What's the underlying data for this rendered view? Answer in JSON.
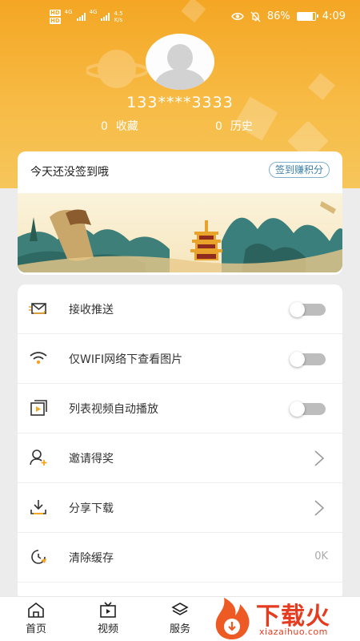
{
  "status_bar": {
    "net_tag_1": "HD",
    "net_tag_2": "HD",
    "sig1_label": "4G",
    "sig2_label": "4G",
    "speed_value": "4.5",
    "speed_unit": "K/s",
    "battery_percent": "86%",
    "battery_level": 0.86,
    "time": "4:09"
  },
  "profile": {
    "phone": "133****3333",
    "favorites_count": "0",
    "favorites_label": "收藏",
    "history_count": "0",
    "history_label": "历史"
  },
  "sign_in": {
    "text": "今天还没签到哦",
    "button_label": "签到赚积分"
  },
  "settings": {
    "push_label": "接收推送",
    "wifi_images_label": "仅WIFI网络下查看图片",
    "autoplay_label": "列表视频自动播放",
    "invite_label": "邀请得奖",
    "share_download_label": "分享下载",
    "clear_cache_label": "清除缓存",
    "cache_size": "0K",
    "push_on": false,
    "wifi_images_on": false,
    "autoplay_on": false
  },
  "bottom_nav": {
    "home_label": "首页",
    "video_label": "视频",
    "service_label": "服务"
  },
  "watermark": {
    "brand": "下载火",
    "url": "xiazaihuo.com"
  },
  "colors": {
    "accent": "#f4a623",
    "brand_red": "#e53b1f",
    "toggle_off": "#bdbdbd"
  }
}
